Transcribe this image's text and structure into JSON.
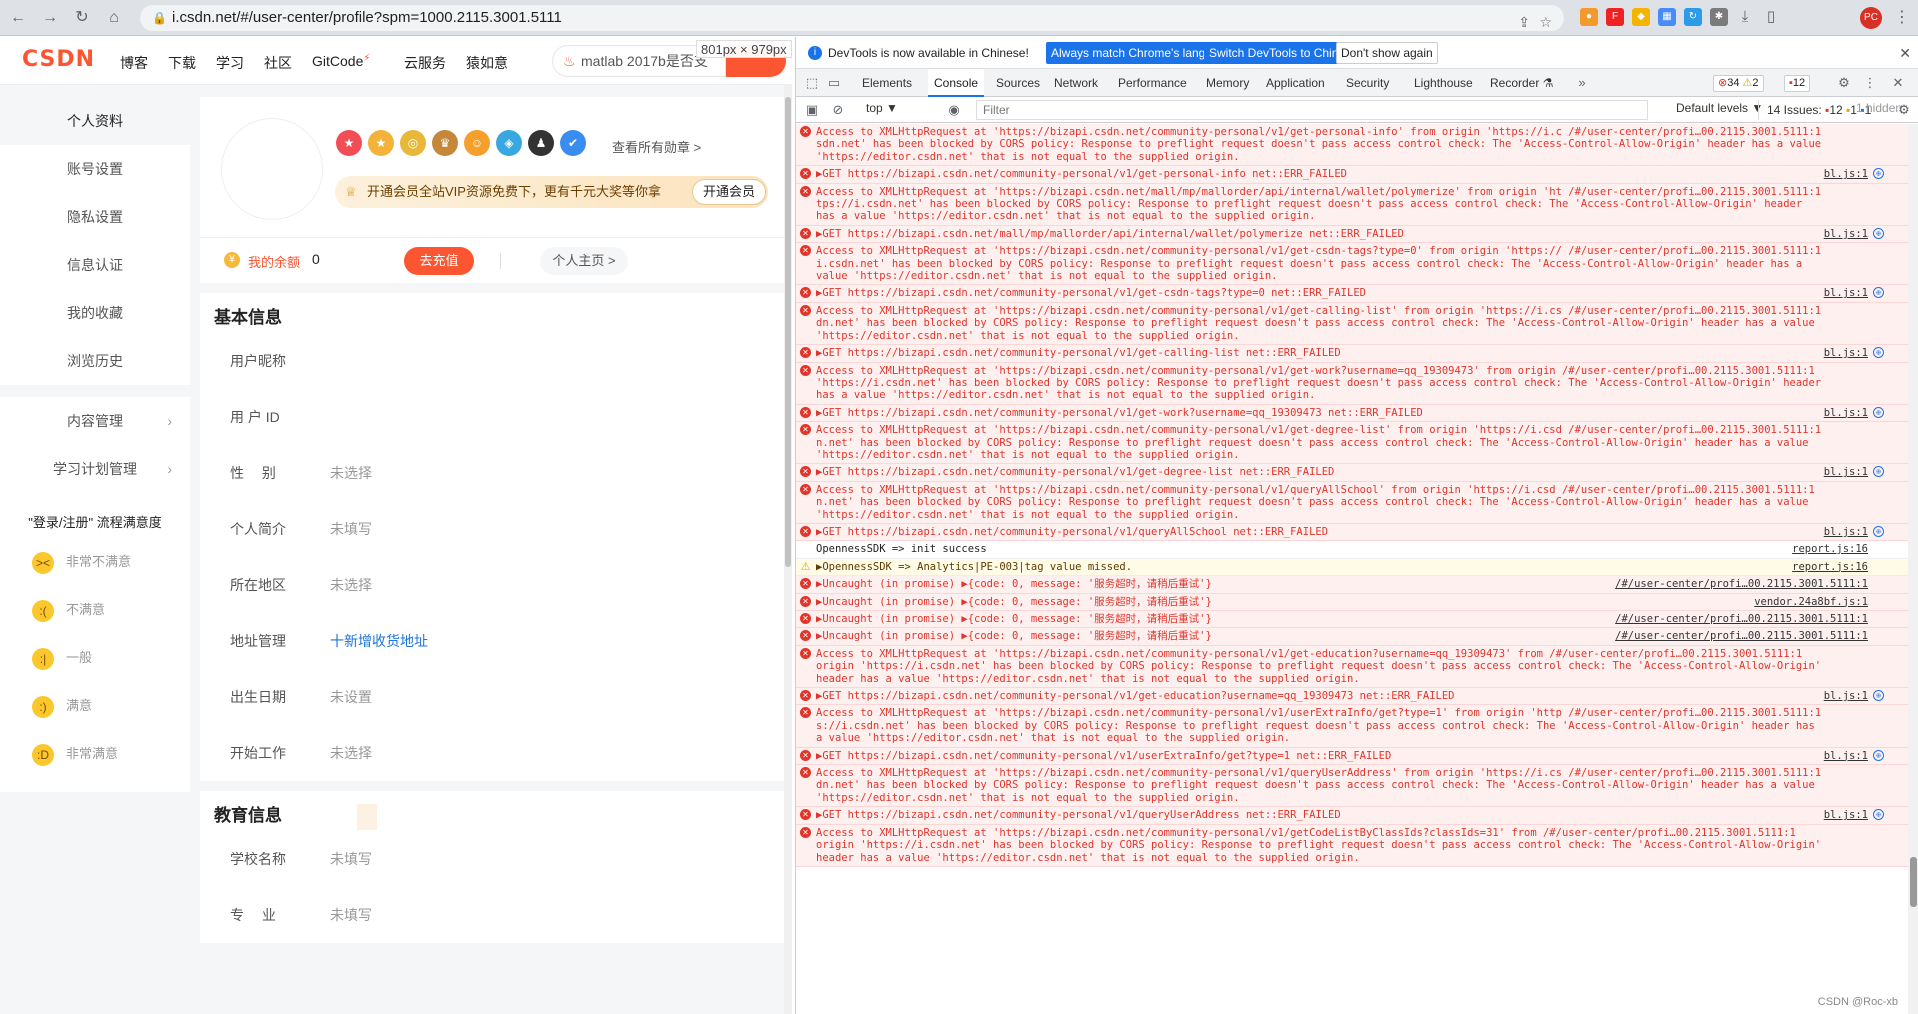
{
  "browser": {
    "url": "i.csdn.net/#/user-center/profile?spm=1000.2115.3001.5111",
    "avatar": "PC"
  },
  "site": {
    "logo": "CSDN",
    "nav": [
      "博客",
      "下载",
      "学习",
      "社区",
      "GitCode",
      "云服务",
      "猿如意"
    ],
    "gitcode_badge": "⚡",
    "search": "matlab 2017b是否支",
    "dim_tip": "801px × 979px"
  },
  "sidebar": {
    "items": [
      "个人资料",
      "账号设置",
      "隐私设置",
      "信息认证",
      "我的收藏",
      "浏览历史"
    ],
    "items2": [
      "内容管理",
      "学习计划管理"
    ]
  },
  "survey": {
    "title": "\"登录/注册\" 流程满意度",
    "options": [
      "非常不满意",
      "不满意",
      "一般",
      "满意",
      "非常满意"
    ]
  },
  "profile": {
    "all_medals": "查看所有勋章 >",
    "vip_text": "开通会员全站VIP资源免费下，更有千元大奖等你拿",
    "vip_button": "开通会员",
    "balance_label": "我的余额",
    "balance_value": "0",
    "topup": "去充值",
    "home": "个人主页 >"
  },
  "basic": {
    "title": "基本信息",
    "fields": [
      {
        "label": "用户昵称",
        "value": ""
      },
      {
        "label": "用 户 ID",
        "value": ""
      },
      {
        "label": "性　 别",
        "value": "未选择"
      },
      {
        "label": "个人简介",
        "value": "未填写"
      },
      {
        "label": "所在地区",
        "value": "未选择"
      },
      {
        "label": "地址管理",
        "value": "十新增收货地址"
      },
      {
        "label": "出生日期",
        "value": "未设置"
      },
      {
        "label": "开始工作",
        "value": "未选择"
      }
    ]
  },
  "education": {
    "title": "教育信息",
    "fields": [
      {
        "label": "学校名称",
        "value": "未填写"
      },
      {
        "label": "专　 业",
        "value": "未填写"
      }
    ]
  },
  "devtools": {
    "info": "DevTools is now available in Chinese!",
    "btn_match": "Always match Chrome's language",
    "btn_switch": "Switch DevTools to Chinese",
    "btn_dont": "Don't show again",
    "tabs": [
      "Elements",
      "Console",
      "Sources",
      "Network",
      "Performance",
      "Memory",
      "Application",
      "Security",
      "Lighthouse",
      "Recorder ⚗"
    ],
    "errors_count": "34",
    "warn_count": "2",
    "err2_count": "12",
    "context": "top ▼",
    "filter": "Filter",
    "levels": "Default levels ▼",
    "issues_label": "14 Issues:",
    "issues_err": "12",
    "issues_warn": "1",
    "issues_info": "1",
    "hidden": "1 hidden",
    "watermark": "CSDN @Roc-xb"
  },
  "console": [
    {
      "t": "err",
      "l": [
        "Access to XMLHttpRequest at 'https://bizapi.csdn.net/community-personal/v1/get-personal-info' from origin 'https://i.c /#/user-center/profi…00.2115.3001.5111:1",
        "sdn.net' has been blocked by CORS policy: Response to preflight request doesn't pass access control check: The 'Access-Control-Allow-Origin' header has a value",
        "'https://editor.csdn.net' that is not equal to the supplied origin."
      ]
    },
    {
      "t": "err",
      "l": [
        "▶GET https://bizapi.csdn.net/community-personal/v1/get-personal-info net::ERR_FAILED"
      ],
      "src": "bl.js:1"
    },
    {
      "t": "err",
      "l": [
        "Access to XMLHttpRequest at 'https://bizapi.csdn.net/mall/mp/mallorder/api/internal/wallet/polymerize' from origin 'ht /#/user-center/profi…00.2115.3001.5111:1",
        "tps://i.csdn.net' has been blocked by CORS policy: Response to preflight request doesn't pass access control check: The 'Access-Control-Allow-Origin' header",
        "has a value 'https://editor.csdn.net' that is not equal to the supplied origin."
      ]
    },
    {
      "t": "err",
      "l": [
        "▶GET https://bizapi.csdn.net/mall/mp/mallorder/api/internal/wallet/polymerize net::ERR_FAILED"
      ],
      "src": "bl.js:1"
    },
    {
      "t": "err",
      "l": [
        "Access to XMLHttpRequest at 'https://bizapi.csdn.net/community-personal/v1/get-csdn-tags?type=0' from origin 'https:// /#/user-center/profi…00.2115.3001.5111:1",
        "i.csdn.net' has been blocked by CORS policy: Response to preflight request doesn't pass access control check: The 'Access-Control-Allow-Origin' header has a",
        "value 'https://editor.csdn.net' that is not equal to the supplied origin."
      ]
    },
    {
      "t": "err",
      "l": [
        "▶GET https://bizapi.csdn.net/community-personal/v1/get-csdn-tags?type=0 net::ERR_FAILED"
      ],
      "src": "bl.js:1"
    },
    {
      "t": "err",
      "l": [
        "Access to XMLHttpRequest at 'https://bizapi.csdn.net/community-personal/v1/get-calling-list' from origin 'https://i.cs /#/user-center/profi…00.2115.3001.5111:1",
        "dn.net' has been blocked by CORS policy: Response to preflight request doesn't pass access control check: The 'Access-Control-Allow-Origin' header has a value",
        "'https://editor.csdn.net' that is not equal to the supplied origin."
      ]
    },
    {
      "t": "err",
      "l": [
        "▶GET https://bizapi.csdn.net/community-personal/v1/get-calling-list net::ERR_FAILED"
      ],
      "src": "bl.js:1"
    },
    {
      "t": "err",
      "l": [
        "Access to XMLHttpRequest at 'https://bizapi.csdn.net/community-personal/v1/get-work?username=qq_19309473' from origin  /#/user-center/profi…00.2115.3001.5111:1",
        "'https://i.csdn.net' has been blocked by CORS policy: Response to preflight request doesn't pass access control check: The 'Access-Control-Allow-Origin' header",
        "has a value 'https://editor.csdn.net' that is not equal to the supplied origin."
      ]
    },
    {
      "t": "err",
      "l": [
        "▶GET https://bizapi.csdn.net/community-personal/v1/get-work?username=qq_19309473 net::ERR_FAILED"
      ],
      "src": "bl.js:1"
    },
    {
      "t": "err",
      "l": [
        "Access to XMLHttpRequest at 'https://bizapi.csdn.net/community-personal/v1/get-degree-list' from origin 'https://i.csd /#/user-center/profi…00.2115.3001.5111:1",
        "n.net' has been blocked by CORS policy: Response to preflight request doesn't pass access control check: The 'Access-Control-Allow-Origin' header has a value",
        "'https://editor.csdn.net' that is not equal to the supplied origin."
      ]
    },
    {
      "t": "err",
      "l": [
        "▶GET https://bizapi.csdn.net/community-personal/v1/get-degree-list net::ERR_FAILED"
      ],
      "src": "bl.js:1"
    },
    {
      "t": "err",
      "l": [
        "Access to XMLHttpRequest at 'https://bizapi.csdn.net/community-personal/v1/queryAllSchool' from origin 'https://i.csd /#/user-center/profi…00.2115.3001.5111:1",
        "n.net' has been blocked by CORS policy: Response to preflight request doesn't pass access control check: The 'Access-Control-Allow-Origin' header has a value",
        "'https://editor.csdn.net' that is not equal to the supplied origin."
      ]
    },
    {
      "t": "err",
      "l": [
        "▶GET https://bizapi.csdn.net/community-personal/v1/queryAllSchool net::ERR_FAILED"
      ],
      "src": "bl.js:1"
    },
    {
      "t": "info",
      "l": [
        "OpennessSDK => init success"
      ],
      "src": "report.js:16"
    },
    {
      "t": "warn",
      "l": [
        "▶OpennessSDK => Analytics|PE-003|tag value missed."
      ],
      "src": "report.js:16"
    },
    {
      "t": "err",
      "l": [
        "▶Uncaught (in promise) ▶{code: 0, message: '服务超时，请稍后重试'}"
      ],
      "src": "/#/user-center/profi…00.2115.3001.5111:1"
    },
    {
      "t": "err",
      "l": [
        "▶Uncaught (in promise) ▶{code: 0, message: '服务超时，请稍后重试'}"
      ],
      "src": "vendor.24a8bf.js:1"
    },
    {
      "t": "err",
      "l": [
        "▶Uncaught (in promise) ▶{code: 0, message: '服务超时，请稍后重试'}"
      ],
      "src": "/#/user-center/profi…00.2115.3001.5111:1"
    },
    {
      "t": "err",
      "l": [
        "▶Uncaught (in promise) ▶{code: 0, message: '服务超时，请稍后重试'}"
      ],
      "src": "/#/user-center/profi…00.2115.3001.5111:1"
    },
    {
      "t": "err",
      "l": [
        "Access to XMLHttpRequest at 'https://bizapi.csdn.net/community-personal/v1/get-education?username=qq_19309473' from /#/user-center/profi…00.2115.3001.5111:1",
        "origin 'https://i.csdn.net' has been blocked by CORS policy: Response to preflight request doesn't pass access control check: The 'Access-Control-Allow-Origin'",
        "header has a value 'https://editor.csdn.net' that is not equal to the supplied origin."
      ]
    },
    {
      "t": "err",
      "l": [
        "▶GET https://bizapi.csdn.net/community-personal/v1/get-education?username=qq_19309473 net::ERR_FAILED"
      ],
      "src": "bl.js:1"
    },
    {
      "t": "err",
      "l": [
        "Access to XMLHttpRequest at 'https://bizapi.csdn.net/community-personal/v1/userExtraInfo/get?type=1' from origin 'http /#/user-center/profi…00.2115.3001.5111:1",
        "s://i.csdn.net' has been blocked by CORS policy: Response to preflight request doesn't pass access control check: The 'Access-Control-Allow-Origin' header has",
        "a value 'https://editor.csdn.net' that is not equal to the supplied origin."
      ]
    },
    {
      "t": "err",
      "l": [
        "▶GET https://bizapi.csdn.net/community-personal/v1/userExtraInfo/get?type=1 net::ERR_FAILED"
      ],
      "src": "bl.js:1"
    },
    {
      "t": "err",
      "l": [
        "Access to XMLHttpRequest at 'https://bizapi.csdn.net/community-personal/v1/queryUserAddress' from origin 'https://i.cs /#/user-center/profi…00.2115.3001.5111:1",
        "dn.net' has been blocked by CORS policy: Response to preflight request doesn't pass access control check: The 'Access-Control-Allow-Origin' header has a value",
        "'https://editor.csdn.net' that is not equal to the supplied origin."
      ]
    },
    {
      "t": "err",
      "l": [
        "▶GET https://bizapi.csdn.net/community-personal/v1/queryUserAddress net::ERR_FAILED"
      ],
      "src": "bl.js:1"
    },
    {
      "t": "err",
      "l": [
        "Access to XMLHttpRequest at 'https://bizapi.csdn.net/community-personal/v1/getCodeListByClassIds?classIds=31' from /#/user-center/profi…00.2115.3001.5111:1",
        "origin 'https://i.csdn.net' has been blocked by CORS policy: Response to preflight request doesn't pass access control check: The 'Access-Control-Allow-Origin'",
        "header has a value 'https://editor.csdn.net' that is not equal to the supplied origin."
      ]
    }
  ]
}
